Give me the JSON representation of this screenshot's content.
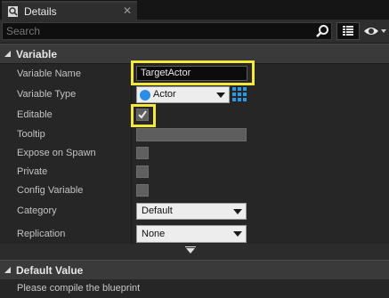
{
  "tab": {
    "title": "Details",
    "icon": "details-magnifier-icon",
    "close": "✕"
  },
  "search": {
    "placeholder": "Search"
  },
  "colors": {
    "highlight": "#f4e93a",
    "actor_icon": "#2b8ee6",
    "grid_icon": "#2b9ae6"
  },
  "variable_section": {
    "title": "Variable",
    "rows": {
      "name": {
        "label": "Variable Name",
        "value": "TargetActor"
      },
      "type": {
        "label": "Variable Type",
        "value": "Actor"
      },
      "editable": {
        "label": "Editable",
        "checked": true
      },
      "tooltip": {
        "label": "Tooltip"
      },
      "expose": {
        "label": "Expose on Spawn",
        "checked": false
      },
      "private": {
        "label": "Private",
        "checked": false
      },
      "config": {
        "label": "Config Variable",
        "checked": false
      },
      "category": {
        "label": "Category",
        "value": "Default"
      },
      "replication": {
        "label": "Replication",
        "value": "None"
      }
    }
  },
  "default_section": {
    "title": "Default Value",
    "message": "Please compile the blueprint"
  }
}
